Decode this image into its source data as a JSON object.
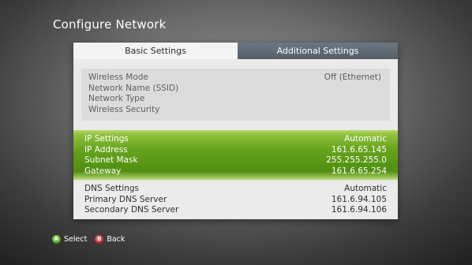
{
  "page": {
    "title": "Configure Network"
  },
  "tabs": [
    {
      "label": "Basic Settings",
      "active": true
    },
    {
      "label": "Additional Settings",
      "active": false
    }
  ],
  "wireless": {
    "rows": [
      {
        "label": "Wireless Mode",
        "value": "Off (Ethernet)"
      },
      {
        "label": "Network Name (SSID)",
        "value": ""
      },
      {
        "label": "Network Type",
        "value": ""
      },
      {
        "label": "Wireless Security",
        "value": ""
      }
    ]
  },
  "ip": {
    "rows": [
      {
        "label": "IP Settings",
        "value": "Automatic"
      },
      {
        "label": "IP Address",
        "value": "161.6.65.145"
      },
      {
        "label": "Subnet Mask",
        "value": "255.255.255.0"
      },
      {
        "label": "Gateway",
        "value": "161.6.65.254"
      }
    ]
  },
  "dns": {
    "rows": [
      {
        "label": "DNS Settings",
        "value": "Automatic"
      },
      {
        "label": "Primary DNS Server",
        "value": "161.6.94.105"
      },
      {
        "label": "Secondary DNS Server",
        "value": "161.6.94.106"
      }
    ]
  },
  "hints": [
    {
      "button": "A",
      "icon": "a-button-icon",
      "label": "Select",
      "color": "#5cbf2a"
    },
    {
      "button": "B",
      "icon": "b-button-icon",
      "label": "Back",
      "color": "#e02a2a"
    }
  ],
  "colors": {
    "accent_green": "#6aa81e",
    "tab_inactive": "#5f6b75",
    "panel_bg": "#eaeaea"
  }
}
